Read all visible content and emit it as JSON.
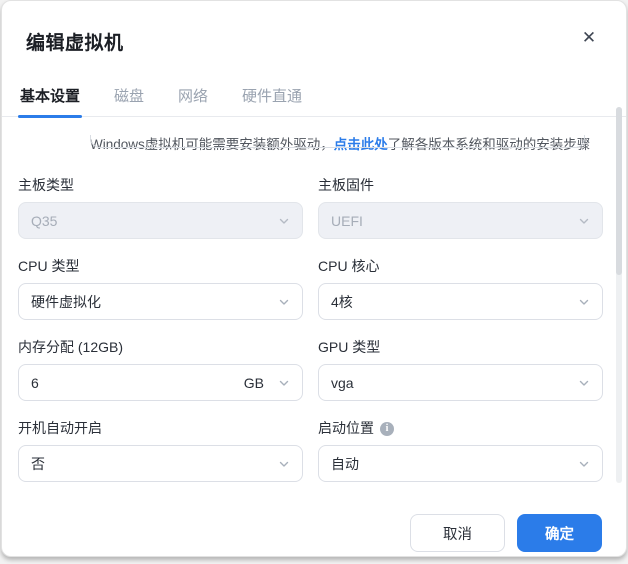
{
  "dialog": {
    "title": "编辑虚拟机",
    "close_glyph": "✕"
  },
  "tabs": [
    {
      "label": "基本设置",
      "active": true
    },
    {
      "label": "磁盘",
      "active": false
    },
    {
      "label": "网络",
      "active": false
    },
    {
      "label": "硬件直通",
      "active": false
    }
  ],
  "notice": {
    "text_before": "Windows虚拟机可能需要安装额外驱动，",
    "link_text": "点击此处",
    "text_after": "了解各版本系统和驱动的安装步骤"
  },
  "form": {
    "motherboard_type": {
      "label": "主板类型",
      "value": "Q35",
      "disabled": true
    },
    "motherboard_firmware": {
      "label": "主板固件",
      "value": "UEFI",
      "disabled": true
    },
    "cpu_type": {
      "label": "CPU 类型",
      "value": "硬件虚拟化"
    },
    "cpu_cores": {
      "label": "CPU 核心",
      "value": "4核"
    },
    "memory": {
      "label": "内存分配 (12GB)",
      "value": "6",
      "unit": "GB"
    },
    "gpu_type": {
      "label": "GPU 类型",
      "value": "vga"
    },
    "auto_start": {
      "label": "开机自动开启",
      "value": "否"
    },
    "boot_location": {
      "label": "启动位置",
      "info_glyph": "i",
      "value": "自动"
    }
  },
  "footer": {
    "cancel_label": "取消",
    "confirm_label": "确定"
  },
  "colors": {
    "accent": "#2b7ce9",
    "link": "#2b7ce9",
    "disabled_bg": "#eef0f5",
    "border": "#dcdfe6",
    "inactive_tab": "#9aa3b0"
  }
}
